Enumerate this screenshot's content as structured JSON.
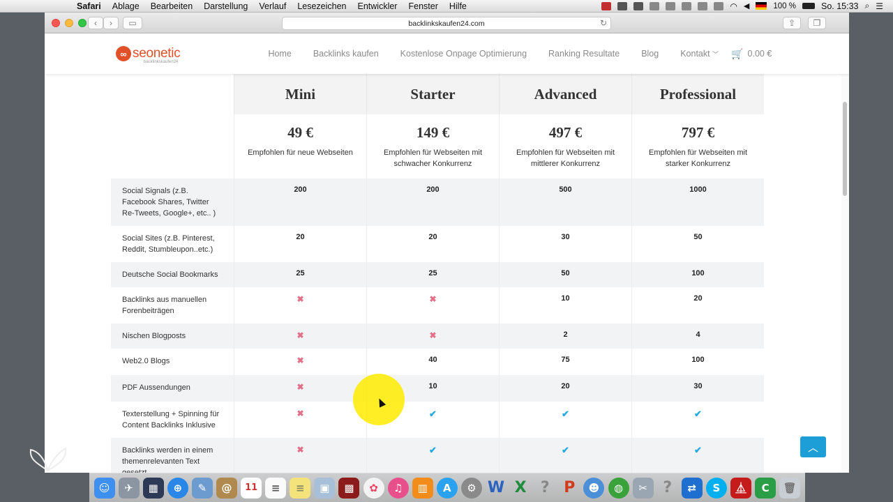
{
  "menubar": {
    "apple": "",
    "items": [
      "Safari",
      "Ablage",
      "Bearbeiten",
      "Darstellung",
      "Verlauf",
      "Lesezeichen",
      "Entwickler",
      "Fenster",
      "Hilfe"
    ],
    "battery": "100 %",
    "clock": "So. 15:33"
  },
  "browser": {
    "url": "backlinkskaufen24.com"
  },
  "site": {
    "logo_text": "seonetic",
    "logo_sub": "backlinkskaufen24",
    "nav": [
      "Home",
      "Backlinks kaufen",
      "Kostenlose Onpage Optimierung",
      "Ranking Resultate",
      "Blog",
      "Kontakt"
    ],
    "cart_total": "0.00 €"
  },
  "pricing": {
    "plans": [
      {
        "name": "Mini",
        "price": "49 €",
        "desc": "Empfohlen für neue Webseiten"
      },
      {
        "name": "Starter",
        "price": "149 €",
        "desc": "Empfohlen für Webseiten mit schwacher Konkurrenz"
      },
      {
        "name": "Advanced",
        "price": "497 €",
        "desc": "Empfohlen für Webseiten mit mittlerer Konkurrenz"
      },
      {
        "name": "Professional",
        "price": "797 €",
        "desc": "Empfohlen für Webseiten mit starker Konkurrenz"
      }
    ],
    "features": [
      {
        "label": "Social Signals (z.B. Facebook Shares, Twitter Re-Tweets, Google+, etc.. )",
        "values": [
          "200",
          "200",
          "500",
          "1000"
        ]
      },
      {
        "label": "Social Sites (z.B. Pinterest, Reddit, Stumbleupon..etc.)",
        "values": [
          "20",
          "20",
          "30",
          "50"
        ]
      },
      {
        "label": "Deutsche Social Bookmarks",
        "values": [
          "25",
          "25",
          "50",
          "100"
        ]
      },
      {
        "label": "Backlinks aus manuellen Forenbeiträgen",
        "values": [
          "✖",
          "✖",
          "10",
          "20"
        ]
      },
      {
        "label": "Nischen Blogposts",
        "values": [
          "✖",
          "✖",
          "2",
          "4"
        ]
      },
      {
        "label": "Web2.0 Blogs",
        "values": [
          "✖",
          "40",
          "75",
          "100"
        ]
      },
      {
        "label": "PDF Aussendungen",
        "values": [
          "✖",
          "10",
          "20",
          "30"
        ]
      },
      {
        "label": "Texterstellung + Spinning für Content Backlinks Inklusive",
        "values": [
          "✖",
          "✔",
          "✔",
          "✔"
        ]
      },
      {
        "label": "Backlinks werden in einem themenrelevanten Text gesetzt",
        "values": [
          "✖",
          "✔",
          "✔",
          "✔"
        ]
      }
    ]
  },
  "colors": {
    "accent": "#1e9ed6",
    "logo": "#e2502a",
    "cross": "#e36f88",
    "check": "#24a9df"
  }
}
